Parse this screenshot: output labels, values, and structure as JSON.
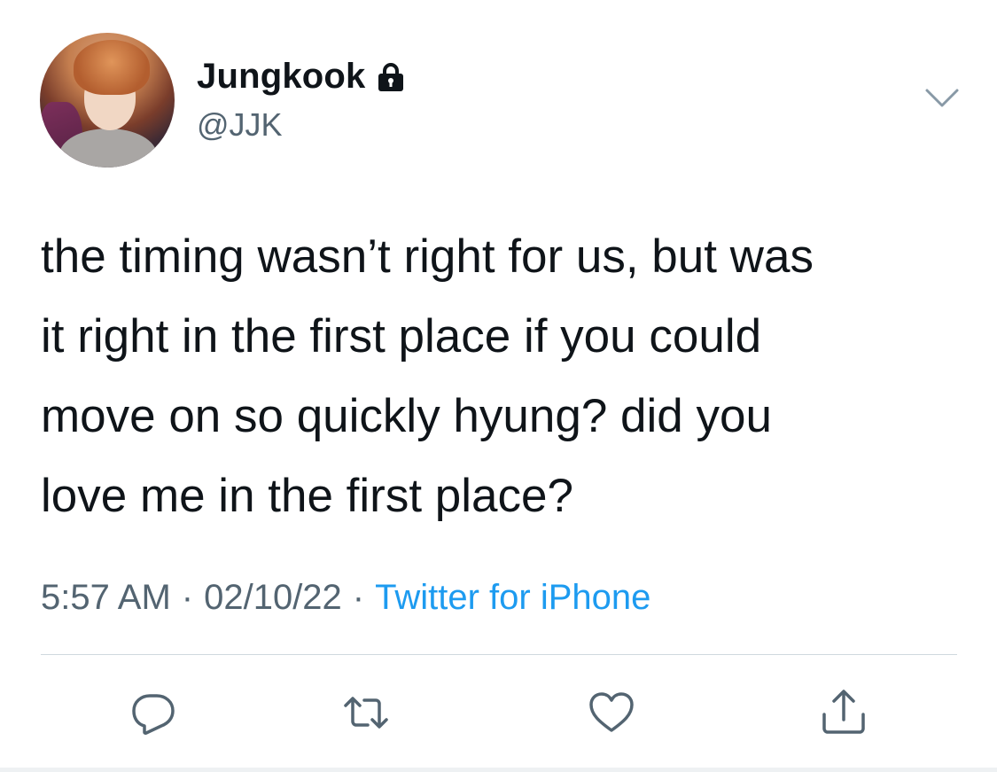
{
  "tweet": {
    "display_name": "Jungkook",
    "handle": "@JJK",
    "protected_icon": "lock-icon",
    "body_lines": [
      "the timing wasn’t right for us, but was",
      "it right in the first place if you could",
      "move on so quickly hyung? did you",
      "love me in the first place?"
    ],
    "time": "5:57 AM",
    "date": "02/10/22",
    "separator": "·",
    "source": "Twitter for iPhone"
  },
  "actions": {
    "reply_icon": "reply-icon",
    "retweet_icon": "retweet-icon",
    "like_icon": "heart-icon",
    "share_icon": "share-icon"
  },
  "colors": {
    "text": "#0f1419",
    "secondary_text": "#536471",
    "link": "#1d9bf0",
    "divider": "#cfd9de"
  }
}
